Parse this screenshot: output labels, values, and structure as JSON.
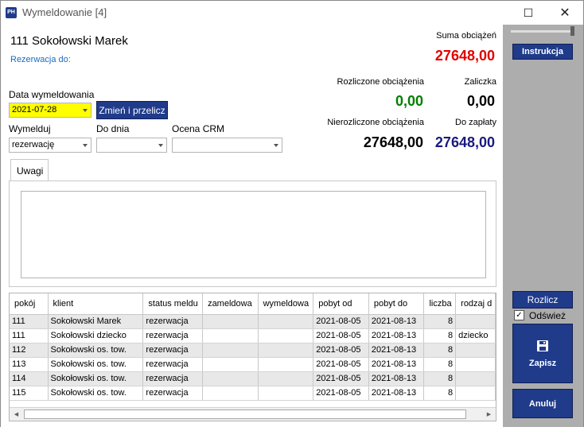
{
  "window": {
    "title": "Wymeldowanie [4]",
    "icon_text": "PH",
    "minimize_label": "☐",
    "close_label": "✕"
  },
  "guest": {
    "name": "111 Sokołowski Marek",
    "reservation_label": "Rezerwacja do:"
  },
  "summary": {
    "total_label": "Suma obciążeń",
    "total_value": "27648,00",
    "settled_label": "Rozliczone obciążenia",
    "settled_value": "0,00",
    "advance_label": "Zaliczka",
    "advance_value": "0,00",
    "unsettled_label": "Nierozliczone obciążenia",
    "unsettled_value": "27648,00",
    "to_pay_label": "Do zapłaty",
    "to_pay_value": "27648,00",
    "colors": {
      "total": "#e00000",
      "settled": "#008000",
      "to_pay": "#1a1a80",
      "default": "#000000"
    }
  },
  "form": {
    "checkout_date_label": "Data wymeldowania",
    "checkout_date_value": "2021-07-28",
    "recalc_button": "Zmień i przelicz",
    "checkout_label": "Wymelduj",
    "checkout_value": "rezerwację",
    "to_day_label": "Do dnia",
    "to_day_value": "",
    "crm_label": "Ocena CRM",
    "crm_value": ""
  },
  "notes": {
    "tab_label": "Uwagi",
    "value": ""
  },
  "table": {
    "columns": [
      "pokój",
      "klient",
      "status meldu",
      "zameldowa",
      "wymeldowa",
      "pobyt od",
      "pobyt do",
      "liczba",
      "rodzaj d"
    ],
    "rows": [
      [
        "111",
        "Sokołowski Marek",
        "rezerwacja",
        "",
        "",
        "2021-08-05",
        "2021-08-13",
        "8",
        ""
      ],
      [
        "111",
        "Sokołowski dziecko",
        "rezerwacja",
        "",
        "",
        "2021-08-05",
        "2021-08-13",
        "8",
        "dziecko"
      ],
      [
        "112",
        "Sokołowski os. tow.",
        "rezerwacja",
        "",
        "",
        "2021-08-05",
        "2021-08-13",
        "8",
        ""
      ],
      [
        "113",
        "Sokołowski os. tow.",
        "rezerwacja",
        "",
        "",
        "2021-08-05",
        "2021-08-13",
        "8",
        ""
      ],
      [
        "114",
        "Sokołowski os. tow.",
        "rezerwacja",
        "",
        "",
        "2021-08-05",
        "2021-08-13",
        "8",
        ""
      ],
      [
        "115",
        "Sokołowski os. tow.",
        "rezerwacja",
        "",
        "",
        "2021-08-05",
        "2021-08-13",
        "8",
        ""
      ]
    ]
  },
  "side": {
    "instrukcja": "Instrukcja",
    "rozlicz": "Rozlicz",
    "odswiez": "Odśwież",
    "odswiez_checked": true,
    "zapisz": "Zapisz",
    "anuluj": "Anuluj"
  }
}
